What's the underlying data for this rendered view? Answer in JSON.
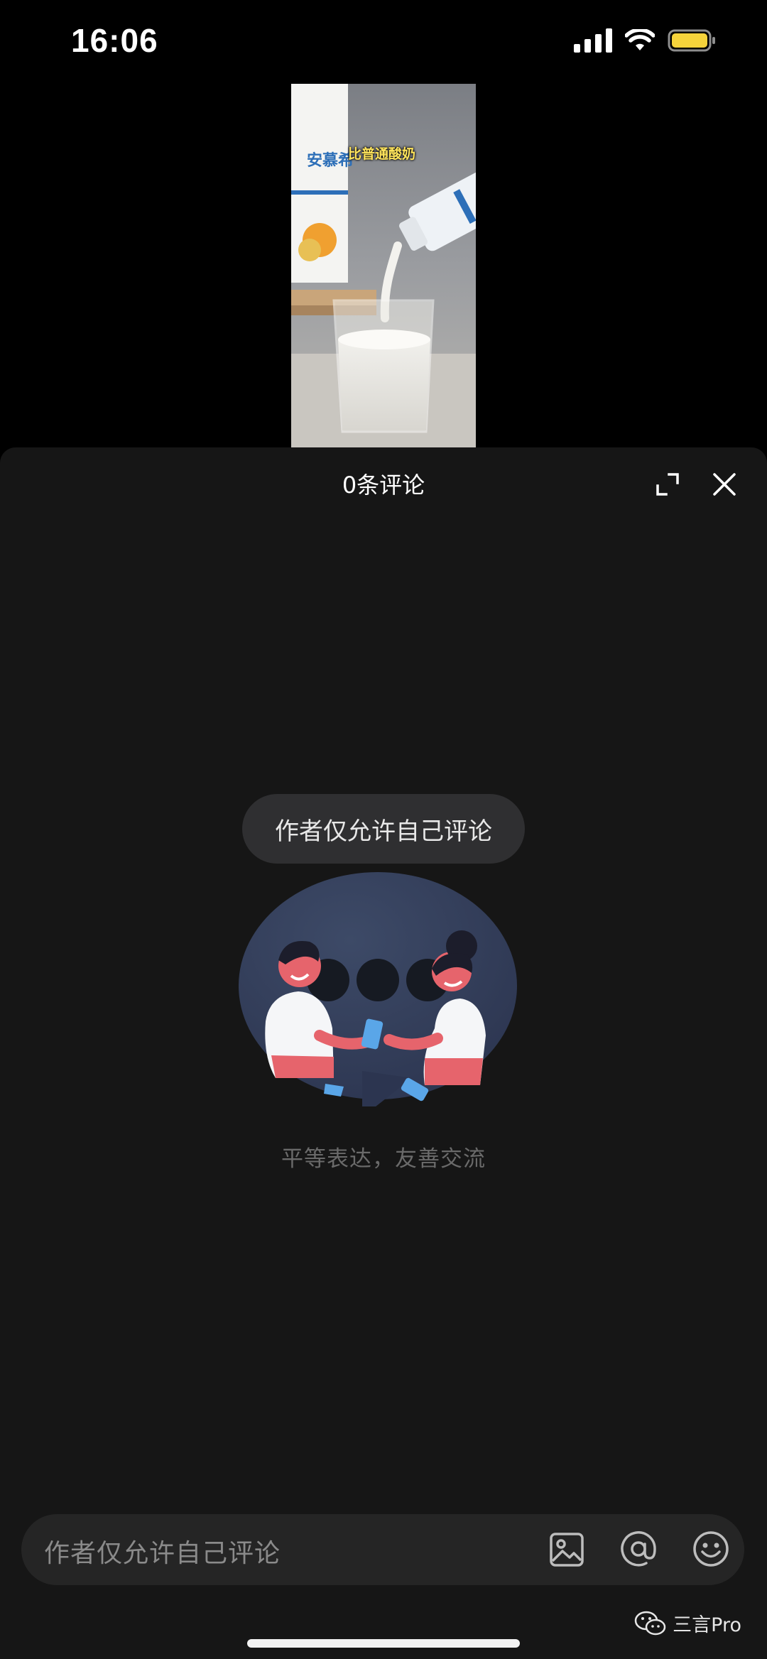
{
  "status_bar": {
    "time": "16:06"
  },
  "video": {
    "caption": "比普通酸奶",
    "brand_text": "安慕希"
  },
  "comments": {
    "title": "0条评论",
    "restriction_notice": "作者仅允许自己评论",
    "empty_caption": "平等表达，友善交流"
  },
  "input": {
    "placeholder": "作者仅允许自己评论"
  },
  "watermark": {
    "text": "三言Pro"
  },
  "icons": {
    "expand": "expand-icon",
    "close": "close-icon",
    "image": "image-icon",
    "mention": "at-icon",
    "emoji": "emoji-icon"
  },
  "colors": {
    "sheet_background": "#161616",
    "pill_background": "#2f2f31",
    "input_background": "#252525",
    "caption_yellow": "#ffe45c",
    "battery_yellow": "#f5d33b"
  }
}
